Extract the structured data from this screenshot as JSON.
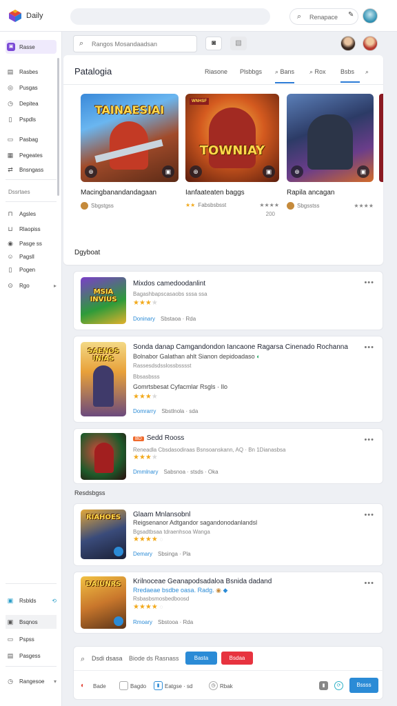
{
  "topbar": {
    "app_title": "Daily",
    "search_label": "Renapace",
    "colors": {
      "logo_a": "#e2473a",
      "logo_b": "#2b7bd6",
      "logo_c": "#f2b21b",
      "logo_d": "#7b49d6"
    }
  },
  "sidebar": {
    "items": [
      {
        "label": "Rasse",
        "icon": "home-icon",
        "active": true
      },
      {
        "label": "Rasbes",
        "icon": "grid-icon"
      },
      {
        "label": "Pusgas",
        "icon": "target-icon"
      },
      {
        "label": "Depitea",
        "icon": "clock-icon"
      },
      {
        "label": "Pspdls",
        "icon": "document-icon"
      },
      {
        "label": "Pasbag",
        "icon": "folder-icon"
      },
      {
        "label": "Pegeates",
        "icon": "calendar-icon"
      },
      {
        "label": "Bnsngass",
        "icon": "share-icon"
      }
    ],
    "section_label": "Dssrtaes",
    "items2": [
      {
        "label": "Agsles",
        "icon": "lock-icon"
      },
      {
        "label": "Rlaopiss",
        "icon": "bag-icon"
      },
      {
        "label": "Pasge ss",
        "icon": "globe-icon"
      },
      {
        "label": "Pagsll",
        "icon": "person-icon"
      },
      {
        "label": "Pogen",
        "icon": "file-icon"
      },
      {
        "label": "Rgo",
        "icon": "info-icon"
      }
    ],
    "bottom_items": [
      {
        "label": "Rsblds",
        "icon": "bookmark-icon"
      },
      {
        "label": "Bsqnos",
        "icon": "box-icon"
      },
      {
        "label": "Pspss",
        "icon": "page-icon"
      },
      {
        "label": "Pasgess",
        "icon": "tray-icon"
      },
      {
        "label": "Rangesoe",
        "icon": "clock-icon"
      }
    ]
  },
  "main": {
    "search_placeholder": "Rangos Mosandaadsan",
    "page_title": "Patalogia",
    "tabs": [
      "Riasone",
      "Plsbbgs",
      "Bans",
      "Rox",
      "Bsbs"
    ],
    "featured": [
      {
        "title": "Macingbanandandagaan",
        "meta": "Sbgstgss",
        "side": "",
        "stars": 0,
        "art_text": "TAINAESIAI",
        "art_sub": ""
      },
      {
        "title": "Ianfaateaten baggs",
        "meta": "Fabsbsbsst",
        "side": "200",
        "stars": 4,
        "art_text": "TOWNIAY",
        "art_sub": "WNHSF"
      },
      {
        "title": "Rapila ancagan",
        "meta": "Sbgsstss",
        "side": "",
        "stars": 4,
        "art_text": "",
        "art_sub": ""
      }
    ],
    "section_subtitle": "Dgyboat",
    "category_label": "Resdsbgss"
  },
  "rows": [
    {
      "title": "Mixdos camedoodanlint",
      "line1": "Bagashbapscasaobs sssa  ssa",
      "stars": 3,
      "link": "Doninary",
      "foot": "Sbstaoa  ·  Rda",
      "art": "MSIA INVIUS"
    },
    {
      "title": "Sonda danap Camgandondon Iancaone Ragarsa Cinenado Rochanna",
      "line1": "Bolnabor Galathan ahlt Sianon depidoadaso",
      "line2": "Rassesdsdsslossbsssst",
      "badge_line": "Bbsasbsss",
      "line3": "Gomrtsbesat Cyfacmlar Rsgls  ·  Ilo",
      "stars": 3,
      "link": "Domrarry",
      "foot": "Sbstlnola  ·  sda",
      "art": "SAENOS INIAS"
    },
    {
      "title": "Sedd Rooss",
      "badge": "BD",
      "line1": "Reneadla Cbsdasodiraas Bsnsoanskann, AQ  ·  Bn 1Dianasbsa",
      "stars": 3,
      "link": "Dmmlnary",
      "foot": "Sabsnoa  ·  stsds  ·  Oka",
      "art": ""
    },
    {
      "title": "Glaam Mnlansobnl",
      "line1": "Reigsenanor Adtgandor sagandonodanlandsl",
      "line2": "Bgsadtbsaa tdraenhsoa  Wanga",
      "stars": 4,
      "link": "Demary",
      "foot": "Sbsinga  ·  Pla",
      "art": "RIAHOES"
    },
    {
      "title": "Krilnoceae Geanapodsadaloa Bsnida dadand",
      "line1": "Rredaeae bsdbe oasa. Radg.",
      "line2": "Rsbasbsmosbedboosd",
      "stars": 4,
      "link": "Rmoary",
      "foot": "Sbstooa  ·  Rda",
      "art": "DAIUNRS"
    }
  ],
  "bottom": {
    "search": "Dsdi dsasa",
    "meta": "Biode ds  Rasnass",
    "btn_blue": "Basta",
    "btn_red": "Bsdaa",
    "items": [
      "Bade",
      "Bagdo",
      "Eatgse  ·  sd",
      "Rbak"
    ],
    "primary": "Bssss",
    "colors": {
      "blue": "#2b8bd6",
      "red": "#e7333f"
    }
  }
}
